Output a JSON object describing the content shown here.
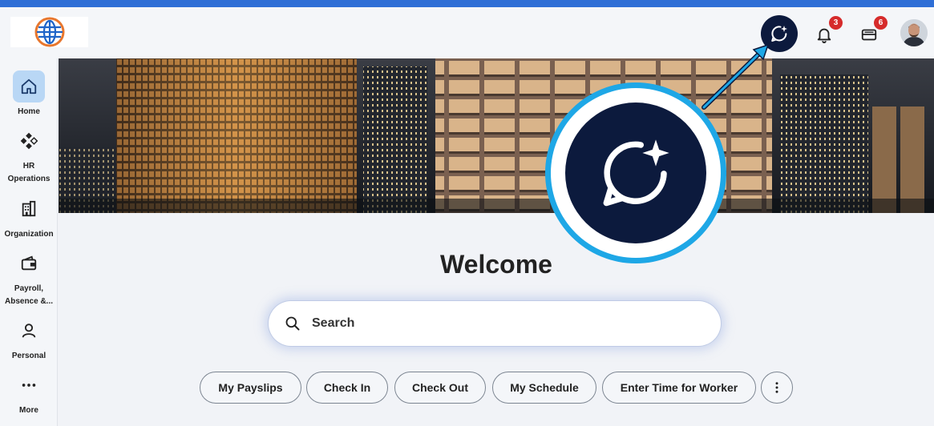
{
  "header": {
    "assistant_icon": "chat-sparkle-icon",
    "notifications": {
      "icon": "bell-icon",
      "count": "3"
    },
    "inbox": {
      "icon": "inbox-icon",
      "count": "6"
    },
    "avatar_icon": "user-avatar"
  },
  "sidebar": {
    "items": [
      {
        "label": "Home",
        "icon": "home-icon",
        "active": true
      },
      {
        "label": "HR\nOperations",
        "icon": "diamond-grid-icon"
      },
      {
        "label": "Organization",
        "icon": "building-icon"
      },
      {
        "label": "Payroll,\nAbsence &...",
        "icon": "wallet-icon"
      },
      {
        "label": "Personal",
        "icon": "person-icon"
      },
      {
        "label": "More",
        "icon": "ellipsis-icon"
      }
    ]
  },
  "main": {
    "welcome": "Welcome",
    "search": {
      "placeholder": "Search",
      "icon": "search-icon"
    },
    "quick_actions": [
      "My Payslips",
      "Check In",
      "Check Out",
      "My Schedule",
      "Enter Time for Worker"
    ],
    "more_actions_icon": "vertical-ellipsis-icon"
  },
  "colors": {
    "top_strip": "#2f6fd6",
    "assistant_bg": "#0c1a3d",
    "badge": "#d62b2b",
    "active_nav": "#b9d7f5",
    "callout_ring": "#1ea7e6"
  }
}
